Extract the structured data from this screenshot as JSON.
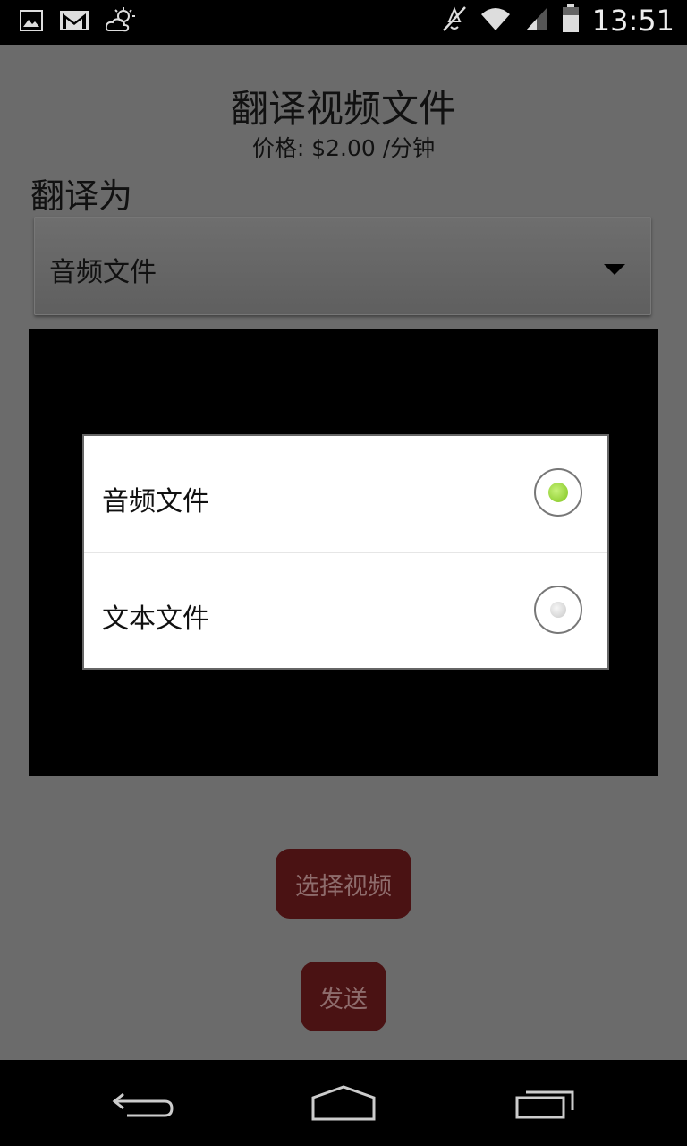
{
  "status_bar": {
    "time": "13:51",
    "left_icons": [
      "image-icon",
      "gmail-icon",
      "weather-icon"
    ],
    "right_icons": [
      "mute-icon",
      "wifi-icon",
      "signal-icon",
      "battery-icon"
    ]
  },
  "page": {
    "title": "翻译视频文件",
    "price": "价格: $2.00 /分钟",
    "translate_to_label": "翻译为",
    "spinner_value": "音频文件"
  },
  "dialog": {
    "options": [
      {
        "label": "音频文件",
        "checked": true
      },
      {
        "label": "文本文件",
        "checked": false
      }
    ]
  },
  "buttons": {
    "select_video": "选择视频",
    "send": "发送"
  },
  "colors": {
    "background": "#6b6b6b",
    "button": "#4a1213",
    "radio_checked": "#7fc41c"
  }
}
